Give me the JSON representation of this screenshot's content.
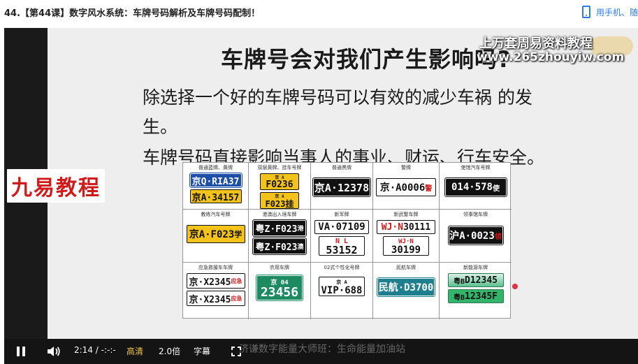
{
  "page": {
    "title": "44.【第44课】数字风水系统：车牌号码解析及车牌号码配制！",
    "mobile_link": "用手机、随"
  },
  "slide": {
    "title": "车牌号会对我们产生影响吗?",
    "line1": "除选择一个好的车牌号码可以有效的减少车祸 的发",
    "line2": "生。",
    "line3": "车牌号码直接影响当事人的事业、财运、行车安全。"
  },
  "watermarks": {
    "brand": "上万套周易资料教程",
    "url": "www.265zhouyiw.com",
    "left": "九易教程",
    "bottom": "济谦数字能量大师班：生命能量加油站"
  },
  "plates": [
    {
      "caption": "普通蓝牌、黄牌",
      "lines": [
        "京Q·RIA37",
        "京A·34157"
      ]
    },
    {
      "caption": "双层黄牌、挂车号牌",
      "lines": [
        "京 A",
        "F0236",
        "京 A",
        "F023挂"
      ]
    },
    {
      "caption": "普通黑牌",
      "lines": [
        "京A·12378"
      ]
    },
    {
      "caption": "警牌",
      "lines": [
        "京·A0006",
        "警"
      ]
    },
    {
      "caption": "使馆汽车号牌",
      "lines": [
        "014·578",
        "使"
      ]
    },
    {
      "caption": "教练汽车号牌",
      "lines": [
        "京A·F023",
        "学"
      ]
    },
    {
      "caption": "港澳出入境车牌",
      "lines": [
        "粤Z·F023",
        "港",
        "粤Z·F023",
        "澳"
      ]
    },
    {
      "caption": "新军牌",
      "lines": [
        "VA·07109",
        "N L",
        "53152"
      ]
    },
    {
      "caption": "新武警车牌",
      "lines": [
        "WJ·N",
        "30111",
        "WJ·N",
        "30199"
      ]
    },
    {
      "caption": "领事馆车牌",
      "lines": [
        "沪A·0023",
        "领"
      ]
    },
    {
      "caption": "应急救援车车牌",
      "lines": [
        "京·X2345",
        "应急",
        "京·X2345",
        "应急"
      ]
    },
    {
      "caption": "农用车牌",
      "lines": [
        "京 04",
        "23456"
      ]
    },
    {
      "caption": "02式个性化号牌",
      "lines": [
        "京 A",
        "VIP·688"
      ]
    },
    {
      "caption": "民航车牌",
      "lines": [
        "民航·D3700"
      ]
    },
    {
      "caption": "新能源车牌",
      "lines": [
        "粤B",
        "D12345",
        "粤B",
        "12345F"
      ]
    }
  ],
  "controls": {
    "time": "2:14 / -:-:-",
    "quality": "高清",
    "speed": "2.0倍",
    "subtitle": "字幕"
  },
  "colors": {
    "quality_accent": "#f2c84b",
    "link_blue": "#2b7de9",
    "watermark_red": "#d11a1a"
  },
  "icons": {
    "mobile": "phone-icon",
    "pause": "pause-icon",
    "volume": "volume-icon",
    "fullscreen": "fullscreen-icon"
  }
}
